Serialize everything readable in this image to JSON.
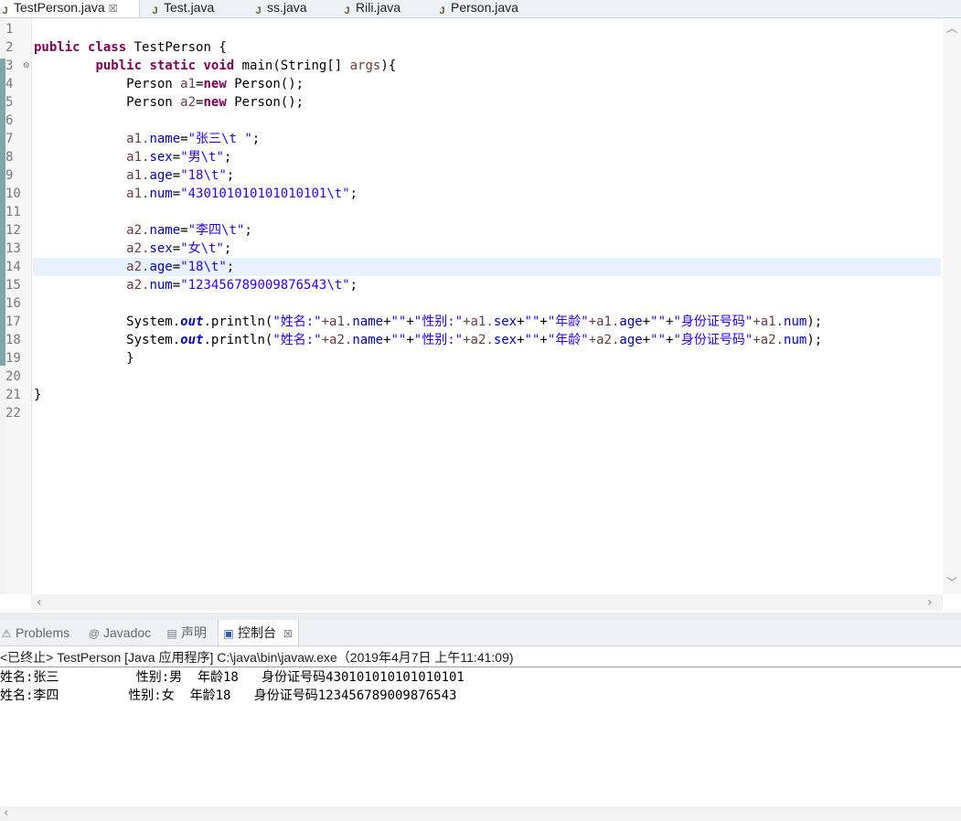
{
  "editor_tabs": [
    {
      "label": "TestPerson.java",
      "active": true,
      "close": "☒"
    },
    {
      "label": "Test.java"
    },
    {
      "label": "ss.java"
    },
    {
      "label": "Rili.java"
    },
    {
      "label": "Person.java"
    }
  ],
  "line_numbers": [
    "1",
    "2",
    "3",
    "4",
    "5",
    "6",
    "7",
    "8",
    "9",
    "10",
    "11",
    "12",
    "13",
    "14",
    "15",
    "16",
    "17",
    "18",
    "19",
    "20",
    "21",
    "22"
  ],
  "fold_marker": "⊖",
  "code": {
    "l2": {
      "kw1": "public",
      "kw2": "class",
      "rest": " TestPerson {"
    },
    "l3": {
      "kw1": "public",
      "kw2": "static",
      "kw3": "void",
      "name": " main(String[] ",
      "param": "args",
      "rest": "){"
    },
    "l4": {
      "type": "Person ",
      "var": "a1",
      "eq": "=",
      "kw": "new",
      "rest": " Person();"
    },
    "l5": {
      "type": "Person ",
      "var": "a2",
      "eq": "=",
      "kw": "new",
      "rest": " Person();"
    },
    "l7": {
      "obj": "a1.",
      "field": "name",
      "eq": "=",
      "str": "\"张三\\t \"",
      "end": ";"
    },
    "l8": {
      "obj": "a1.",
      "field": "sex",
      "eq": "=",
      "str": "\"男\\t\"",
      "end": ";"
    },
    "l9": {
      "obj": "a1.",
      "field": "age",
      "eq": "=",
      "str": "\"18\\t\"",
      "end": ";"
    },
    "l10": {
      "obj": "a1.",
      "field": "num",
      "eq": "=",
      "str": "\"430101010101010101\\t\"",
      "end": ";"
    },
    "l12": {
      "obj": "a2.",
      "field": "name",
      "eq": "=",
      "str": "\"李四\\t\"",
      "end": ";"
    },
    "l13": {
      "obj": "a2.",
      "field": "sex",
      "eq": "=",
      "str": "\"女\\t\"",
      "end": ";"
    },
    "l14": {
      "obj": "a2.",
      "field": "age",
      "eq": "=",
      "str": "\"18\\t\"",
      "end": ";"
    },
    "l15": {
      "obj": "a2.",
      "field": "num",
      "eq": "=",
      "str": "\"123456789009876543\\t\"",
      "end": ";"
    },
    "l17": {
      "pre": "System.",
      "out": "out",
      "call": ".println(",
      "s1": "\"姓名:\"",
      "p1": "+a1.",
      "f1": "name",
      "p2": "+",
      "s2": "\"\"",
      "p3": "+",
      "s3": "\"性别:\"",
      "p4": "+a1.",
      "f2": "sex",
      "p5": "+",
      "s4": "\"\"",
      "p6": "+",
      "s5": "\"年龄\"",
      "p7": "+a1.",
      "f3": "age",
      "p8": "+",
      "s6": "\"\"",
      "p9": "+",
      "s7": "\"身份证号码\"",
      "p10": "+a1.",
      "f4": "num",
      "end": ");"
    },
    "l18": {
      "pre": "System.",
      "out": "out",
      "call": ".println(",
      "s1": "\"姓名:\"",
      "p1": "+a2.",
      "f1": "name",
      "p2": "+",
      "s2": "\"\"",
      "p3": "+",
      "s3": "\"性别:\"",
      "p4": "+a2.",
      "f2": "sex",
      "p5": "+",
      "s4": "\"\"",
      "p6": "+",
      "s5": "\"年龄\"",
      "p7": "+a2.",
      "f3": "age",
      "p8": "+",
      "s6": "\"\"",
      "p9": "+",
      "s7": "\"身份证号码\"",
      "p10": "+a2.",
      "f4": "num",
      "end": ");"
    },
    "l19": "}",
    "l21": "}"
  },
  "view_tabs": [
    {
      "label": "Problems",
      "icon": "problems-icon"
    },
    {
      "label": "Javadoc",
      "icon": "at-icon"
    },
    {
      "label": "声明",
      "icon": "declaration-icon"
    },
    {
      "label": "控制台",
      "icon": "console-icon",
      "active": true,
      "close": "☒"
    }
  ],
  "console": {
    "header": "<已终止> TestPerson [Java 应用程序] C:\\java\\bin\\javaw.exe（2019年4月7日 上午11:41:09)",
    "lines": [
      "姓名:张三          性别:男  年龄18   身份证号码430101010101010101",
      "姓名:李四         性别:女  年龄18   身份证号码123456789009876543"
    ]
  },
  "scroll": {
    "up": "︿",
    "down": "﹀",
    "left": "‹",
    "right": "›"
  },
  "colors": {
    "keyword": "#7f0055",
    "string": "#2a00ff",
    "field": "#0000c0",
    "current_line": "#e8f2fe"
  }
}
